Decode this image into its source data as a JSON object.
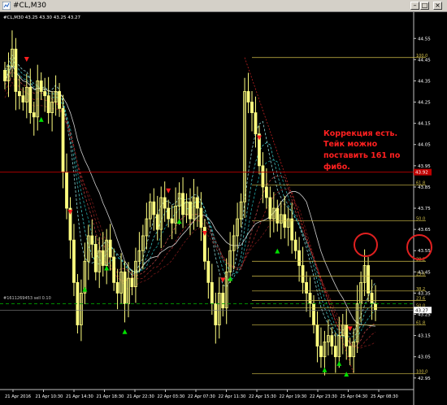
{
  "window": {
    "title": "#CL,M30",
    "buttons": [
      "minimize",
      "maximize",
      "close"
    ]
  },
  "header": {
    "text": "#CL,M30  43.25 43.30 43.25 43.27"
  },
  "annotation": {
    "line1": "Коррекция есть.",
    "line2": "Тейк можно",
    "line3": "поставить 161 по",
    "line4": "фибо."
  },
  "order_label": "#1611269453 sell 0.10",
  "price_axis": {
    "labels": [
      "44.55",
      "44.45",
      "44.35",
      "44.25",
      "44.15",
      "44.05",
      "43.95",
      "43.85",
      "43.75",
      "43.65",
      "43.55",
      "43.45",
      "43.35",
      "43.25",
      "43.15",
      "43.05",
      "42.95"
    ],
    "tags": [
      {
        "text": "43.92",
        "color": "#c00000",
        "price": 43.92
      },
      {
        "text": "43.27",
        "color": "#ffffff",
        "price": 43.27
      }
    ]
  },
  "time_axis": {
    "labels": [
      "21 Apr 2016",
      "21 Apr 10:30",
      "21 Apr 14:30",
      "21 Apr 18:30",
      "21 Apr 22:30",
      "22 Apr 03:30",
      "22 Apr 07:30",
      "22 Apr 11:30",
      "22 Apr 15:30",
      "22 Apr 19:30",
      "22 Apr 23:30",
      "25 Apr 04:30",
      "25 Apr 08:30"
    ]
  },
  "fibo_levels": [
    {
      "label": "100.0",
      "price": 44.46
    },
    {
      "label": "61.8",
      "price": 43.86
    },
    {
      "label": "50.0",
      "price": 43.69
    },
    {
      "label": "38.2",
      "price": 43.5
    },
    {
      "label": "23.6",
      "price": 43.43
    },
    {
      "label": "38.2",
      "price": 43.36
    },
    {
      "label": "23.6",
      "price": 43.315
    },
    {
      "label": "50.0",
      "price": 43.28
    },
    {
      "label": "61.8",
      "price": 43.2
    },
    {
      "label": "100.0",
      "price": 42.97
    }
  ],
  "colors": {
    "background": "#000000",
    "candle": "#ffff80",
    "grid_text": "#ffffff",
    "fibo": "#d4c04a",
    "annotation": "#ff2020",
    "circle": "#e02020",
    "up_arrow": "#00e000",
    "down_arrow": "#ff2020",
    "red_hline": "#c00000",
    "order_line": "#00a000"
  },
  "chart_data": {
    "type": "candlestick",
    "instrument": "#CL",
    "timeframe": "M30",
    "ylim": [
      42.93,
      44.62
    ],
    "closes": [
      44.35,
      44.42,
      44.5,
      44.3,
      44.28,
      44.25,
      44.32,
      44.2,
      44.18,
      44.35,
      44.3,
      44.28,
      44.2,
      44.25,
      44.3,
      44.22,
      43.92,
      43.75,
      43.6,
      43.4,
      43.2,
      43.35,
      43.5,
      43.62,
      43.58,
      43.45,
      43.55,
      43.48,
      43.6,
      43.52,
      43.4,
      43.35,
      43.45,
      43.3,
      43.42,
      43.38,
      43.5,
      43.55,
      43.62,
      43.7,
      43.78,
      43.72,
      43.65,
      43.8,
      43.75,
      43.7,
      43.68,
      43.76,
      43.82,
      43.72,
      43.78,
      43.7,
      43.8,
      43.75,
      43.66,
      43.5,
      43.4,
      43.3,
      43.2,
      43.35,
      43.28,
      43.45,
      43.55,
      43.62,
      43.7,
      43.78,
      44.3,
      44.25,
      44.2,
      44.1,
      43.95,
      43.85,
      43.8,
      43.7,
      43.75,
      43.68,
      43.72,
      43.66,
      43.7,
      43.6,
      43.55,
      43.48,
      43.4,
      43.35,
      43.3,
      43.2,
      43.1,
      43.05,
      43.12,
      43.15,
      43.1,
      43.05,
      43.15,
      43.2,
      43.1,
      43.05,
      43.12,
      43.3,
      43.4,
      43.48,
      43.35,
      43.3,
      43.27
    ]
  }
}
